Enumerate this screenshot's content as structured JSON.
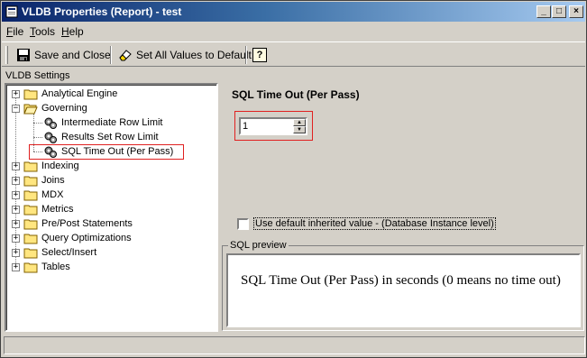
{
  "window": {
    "title": "VLDB Properties (Report) - test",
    "controls": {
      "minimize": "_",
      "maximize": "□",
      "close": "×"
    }
  },
  "menu": [
    {
      "label": "File",
      "mnemonic": "F",
      "rest": "ile"
    },
    {
      "label": "Tools",
      "mnemonic": "T",
      "rest": "ools"
    },
    {
      "label": "Help",
      "mnemonic": "H",
      "rest": "elp"
    }
  ],
  "toolbar": {
    "save_close": {
      "label": "Save and Close",
      "icon": "floppy-disk-icon"
    },
    "set_default": {
      "label": "Set All Values to Default",
      "icon": "eraser-icon"
    },
    "help": {
      "label": "?",
      "icon": "help-icon"
    }
  },
  "section_label": "VLDB Settings",
  "tree": [
    {
      "label": "Analytical Engine",
      "expander": "+",
      "icon": "folder-icon",
      "level": 0
    },
    {
      "label": "Governing",
      "expander": "−",
      "icon": "folder-open-icon",
      "level": 0
    },
    {
      "label": "Intermediate Row Limit",
      "icon": "gear-icon",
      "level": 1
    },
    {
      "label": "Results Set Row Limit",
      "icon": "gear-icon",
      "level": 1
    },
    {
      "label": "SQL Time Out (Per Pass)",
      "icon": "gear-icon",
      "level": 1,
      "selected": true
    },
    {
      "label": "Indexing",
      "expander": "+",
      "icon": "folder-icon",
      "level": 0
    },
    {
      "label": "Joins",
      "expander": "+",
      "icon": "folder-icon",
      "level": 0
    },
    {
      "label": "MDX",
      "expander": "+",
      "icon": "folder-icon",
      "level": 0
    },
    {
      "label": "Metrics",
      "expander": "+",
      "icon": "folder-icon",
      "level": 0
    },
    {
      "label": "Pre/Post Statements",
      "expander": "+",
      "icon": "folder-icon",
      "level": 0
    },
    {
      "label": "Query Optimizations",
      "expander": "+",
      "icon": "folder-icon",
      "level": 0
    },
    {
      "label": "Select/Insert",
      "expander": "+",
      "icon": "folder-icon",
      "level": 0
    },
    {
      "label": "Tables",
      "expander": "+",
      "icon": "folder-icon",
      "level": 0
    }
  ],
  "setting": {
    "title": "SQL Time Out (Per Pass)",
    "value": "1",
    "use_default_label": "Use default inherited value - (Database Instance level)",
    "use_default_checked": false
  },
  "preview": {
    "legend": "SQL preview",
    "text": "SQL Time Out (Per Pass) in seconds (0 means no time out)"
  },
  "status": {
    "text": ""
  }
}
